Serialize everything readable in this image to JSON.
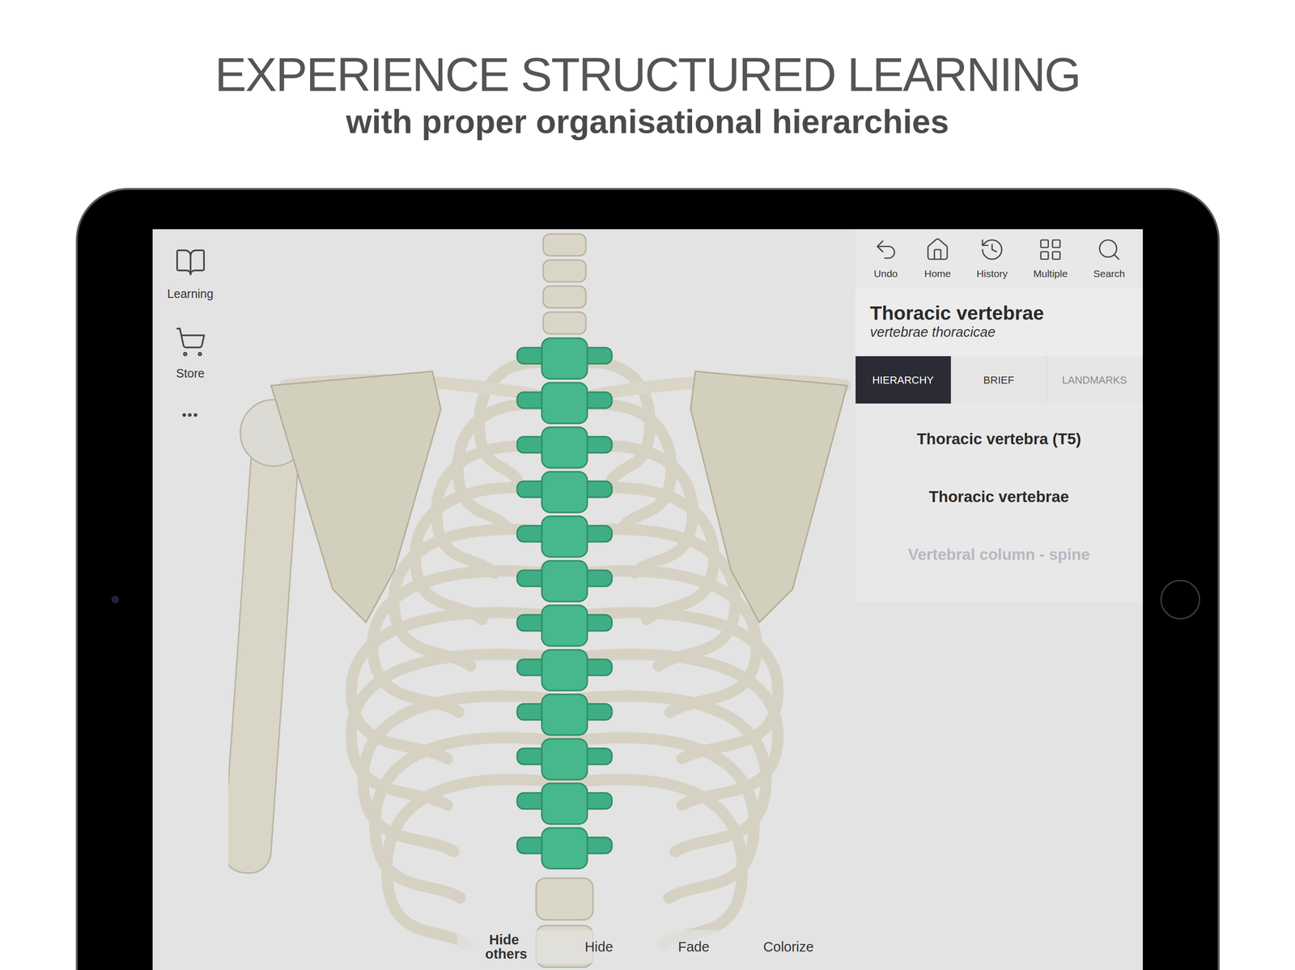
{
  "header": {
    "title": "EXPERIENCE STRUCTURED LEARNING",
    "subtitle": "with proper organisational hierarchies"
  },
  "sidebar": {
    "items": [
      {
        "label": "Learning",
        "icon": "book"
      },
      {
        "label": "Store",
        "icon": "store"
      }
    ],
    "more": "•••"
  },
  "toolbar": [
    {
      "label": "Undo",
      "icon": "undo"
    },
    {
      "label": "Home",
      "icon": "home"
    },
    {
      "label": "History",
      "icon": "history"
    },
    {
      "label": "Multiple",
      "icon": "grid"
    },
    {
      "label": "Search",
      "icon": "search"
    }
  ],
  "selection": {
    "name": "Thoracic vertebrae",
    "latin": "vertebrae thoracicae"
  },
  "tabs": [
    {
      "label": "HIERARCHY",
      "selected": true,
      "disabled": false
    },
    {
      "label": "BRIEF",
      "selected": false,
      "disabled": false
    },
    {
      "label": "LANDMARKS",
      "selected": false,
      "disabled": true
    }
  ],
  "hierarchy": [
    {
      "label": "Thoracic vertebra (T5)",
      "dimmed": false
    },
    {
      "label": "Thoracic vertebrae",
      "dimmed": false
    },
    {
      "label": "Vertebral column - spine",
      "dimmed": true
    }
  ],
  "actions": [
    {
      "label": "Hide others",
      "emphasized": true
    },
    {
      "label": "Hide",
      "emphasized": false
    },
    {
      "label": "Fade",
      "emphasized": false
    },
    {
      "label": "Colorize",
      "emphasized": false
    }
  ]
}
